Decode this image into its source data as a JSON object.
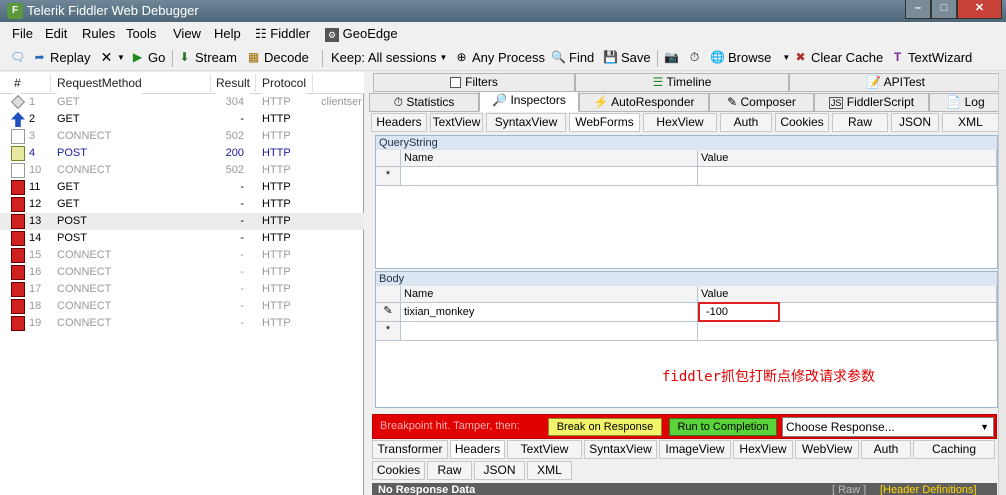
{
  "window": {
    "title": "Telerik Fiddler Web Debugger",
    "app_icon": "F"
  },
  "menu": [
    "File",
    "Edit",
    "Rules",
    "Tools",
    "View",
    "Help",
    "Fiddler",
    "GeoEdge"
  ],
  "toolbar": {
    "replay": "Replay",
    "go": "Go",
    "stream": "Stream",
    "decode": "Decode",
    "keep": "Keep: All sessions",
    "any_process": "Any Process",
    "find": "Find",
    "save": "Save",
    "browse": "Browse",
    "clear_cache": "Clear Cache",
    "textwizard": "TextWizard"
  },
  "sessions": {
    "columns": {
      "num": "#",
      "method": "RequestMethod",
      "result": "Result",
      "protocol": "Protocol"
    },
    "host_fragment": "clientser",
    "rows": [
      {
        "num": "1",
        "method": "GET",
        "result": "304",
        "protocol": "HTTP",
        "style": "gray",
        "icon": "diamond-icon"
      },
      {
        "num": "2",
        "method": "GET",
        "result": "-",
        "protocol": "HTTP",
        "style": "black",
        "icon": "up-arrow-icon"
      },
      {
        "num": "3",
        "method": "CONNECT",
        "result": "502",
        "protocol": "HTTP",
        "style": "gray",
        "icon": "page-icon"
      },
      {
        "num": "4",
        "method": "POST",
        "result": "200",
        "protocol": "HTTP",
        "style": "blue",
        "icon": "post-icon"
      },
      {
        "num": "10",
        "method": "CONNECT",
        "result": "502",
        "protocol": "HTTP",
        "style": "gray",
        "icon": "page-icon"
      },
      {
        "num": "11",
        "method": "GET",
        "result": "-",
        "protocol": "HTTP",
        "style": "black",
        "icon": "breakpoint-icon"
      },
      {
        "num": "12",
        "method": "GET",
        "result": "-",
        "protocol": "HTTP",
        "style": "black",
        "icon": "breakpoint-icon"
      },
      {
        "num": "13",
        "method": "POST",
        "result": "-",
        "protocol": "HTTP",
        "style": "black",
        "icon": "breakpoint-icon"
      },
      {
        "num": "14",
        "method": "POST",
        "result": "-",
        "protocol": "HTTP",
        "style": "black",
        "icon": "breakpoint-icon"
      },
      {
        "num": "15",
        "method": "CONNECT",
        "result": "-",
        "protocol": "HTTP",
        "style": "gray",
        "icon": "breakpoint-icon"
      },
      {
        "num": "16",
        "method": "CONNECT",
        "result": "-",
        "protocol": "HTTP",
        "style": "gray",
        "icon": "breakpoint-icon"
      },
      {
        "num": "17",
        "method": "CONNECT",
        "result": "-",
        "protocol": "HTTP",
        "style": "gray",
        "icon": "breakpoint-icon"
      },
      {
        "num": "18",
        "method": "CONNECT",
        "result": "-",
        "protocol": "HTTP",
        "style": "gray",
        "icon": "breakpoint-icon"
      },
      {
        "num": "19",
        "method": "CONNECT",
        "result": "-",
        "protocol": "HTTP",
        "style": "gray",
        "icon": "breakpoint-icon"
      }
    ]
  },
  "tabs_top": [
    "Filters",
    "Timeline",
    "APITest"
  ],
  "tabs_main": [
    "Statistics",
    "Inspectors",
    "AutoResponder",
    "Composer",
    "FiddlerScript",
    "Log"
  ],
  "request_tabs": [
    "Headers",
    "TextView",
    "SyntaxView",
    "WebForms",
    "HexView",
    "Auth",
    "Cookies",
    "Raw",
    "JSON",
    "XML"
  ],
  "querystring": {
    "title": "QueryString",
    "name_col": "Name",
    "value_col": "Value",
    "new_row_marker": "*"
  },
  "body": {
    "title": "Body",
    "name_col": "Name",
    "value_col": "Value",
    "row": {
      "name": "tixian_monkey",
      "value": "-100"
    },
    "new_row_marker": "*"
  },
  "annotation": "fiddler抓包打断点修改请求参数",
  "breakpoint": {
    "label": "Breakpoint hit. Tamper, then:",
    "break_on_response": "Break on Response",
    "run_to_completion": "Run to Completion",
    "choose_response": "Choose Response..."
  },
  "response_tabs_row1": [
    "Transformer",
    "Headers",
    "TextView",
    "SyntaxView",
    "ImageView",
    "HexView",
    "WebView",
    "Auth",
    "Caching"
  ],
  "response_tabs_row2": [
    "Cookies",
    "Raw",
    "JSON",
    "XML"
  ],
  "response_status": {
    "text": "No Response Data",
    "raw": "[ Raw ]",
    "header_defs": "[Header Definitions]"
  },
  "colors": {
    "breakpoint_bar": "#e00000",
    "annotation": "#e00000",
    "highlight_box": "#e02020"
  }
}
